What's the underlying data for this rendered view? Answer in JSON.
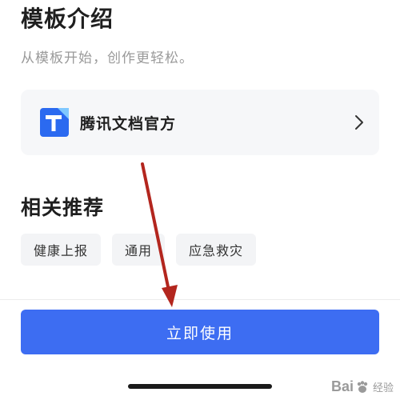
{
  "template_intro": {
    "title": "模板介绍",
    "description": "从模板开始，创作更轻松。"
  },
  "publisher": {
    "name": "腾讯文档官方",
    "logo_icon": "tencent-docs-logo-icon",
    "chevron_icon": "chevron-right-icon"
  },
  "related": {
    "title": "相关推荐",
    "tags": [
      {
        "label": "健康上报"
      },
      {
        "label": "通用"
      },
      {
        "label": "应急救灾"
      }
    ]
  },
  "actions": {
    "use_now_label": "立即使用"
  },
  "annotation": {
    "arrow_icon": "red-arrow-annotation",
    "color": "#b3261e"
  },
  "watermark": {
    "brand": "Bai",
    "suffix": "经验"
  },
  "colors": {
    "primary": "#3d6df2",
    "logo_blue": "#2b6af0",
    "logo_light": "#7fc8ff"
  }
}
